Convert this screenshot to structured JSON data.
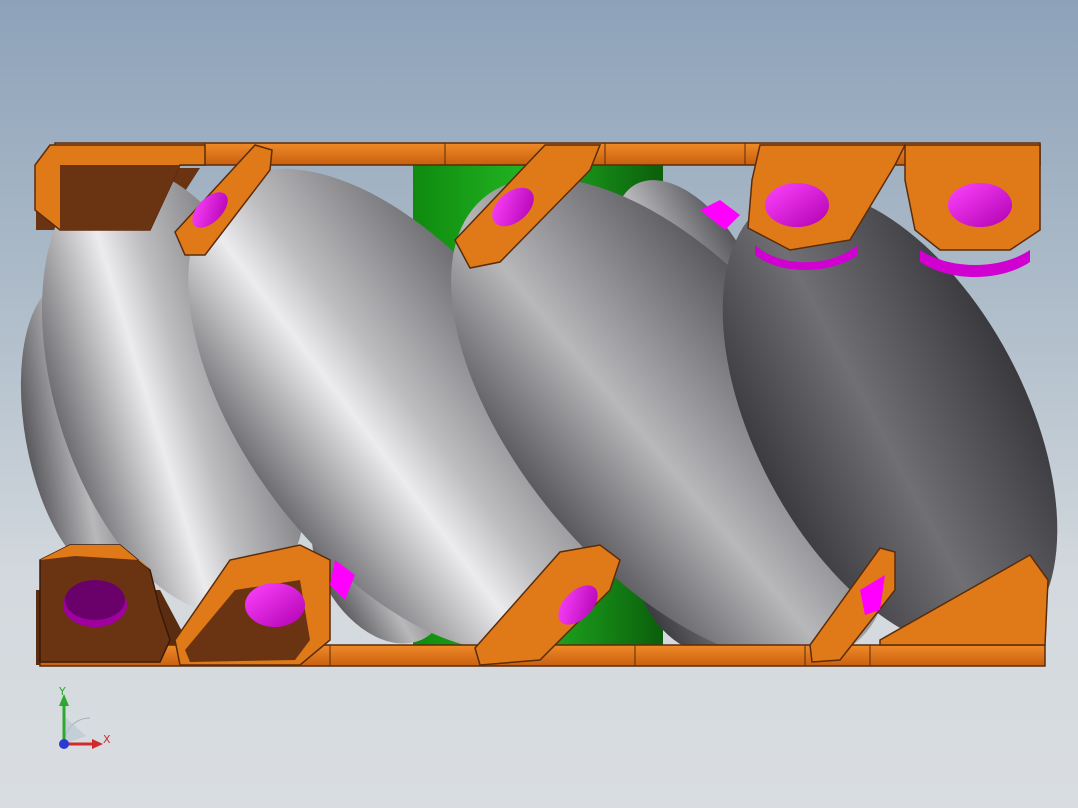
{
  "viewport": {
    "background_top": "#8da2b9",
    "background_bottom": "#d9dde1"
  },
  "model": {
    "colors": {
      "frame_plate": "#e07a18",
      "frame_shadow": "#6a3412",
      "roller_body": "#8c8c8e",
      "roller_dark": "#4a4a4e",
      "roller_pin": "#ff00ff",
      "hub": "#14a014",
      "hub_dark": "#0b6a0b"
    }
  },
  "triad": {
    "x_label": "X",
    "y_label": "Y",
    "x_color": "#d22a2a",
    "y_color": "#2ea82e",
    "z_color": "#2a3ad2"
  }
}
